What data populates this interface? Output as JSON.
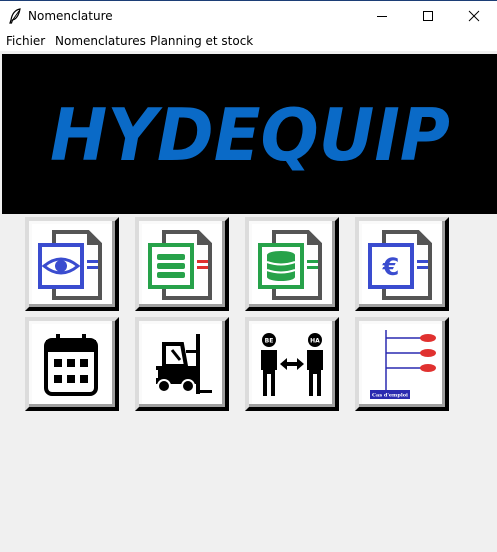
{
  "window": {
    "title": "Nomenclature"
  },
  "menu": {
    "items": [
      "Fichier",
      "Nomenclatures",
      "Planning et stock"
    ]
  },
  "banner": {
    "logo_text": "HYDEQUIP",
    "logo_color": "#0a6ac7"
  },
  "tiles": [
    {
      "icon": "document-view-icon"
    },
    {
      "icon": "document-list-icon"
    },
    {
      "icon": "document-database-icon"
    },
    {
      "icon": "document-euro-icon",
      "symbol": "€"
    },
    {
      "icon": "calendar-icon"
    },
    {
      "icon": "forklift-icon"
    },
    {
      "icon": "people-exchange-icon",
      "left_badge": "BE",
      "right_badge": "HA"
    },
    {
      "icon": "where-used-tree-icon",
      "caption": "Cas d'emploi"
    }
  ]
}
